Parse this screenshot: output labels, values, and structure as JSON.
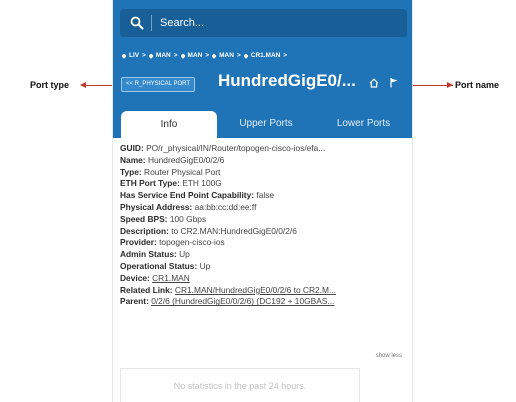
{
  "annotations": {
    "port_type": "Port type",
    "port_name": "Port name"
  },
  "search": {
    "placeholder": "Search..."
  },
  "breadcrumb": [
    "LIV",
    "MAN",
    "MAN",
    "MAN",
    "CR1.MAN"
  ],
  "breadcrumb_separator": ">",
  "header": {
    "port_type_badge": "<< R_PHYSICAL PORT",
    "port_name": "HundredGigE0/..."
  },
  "tabs": [
    "Info",
    "Upper Ports",
    "Lower Ports"
  ],
  "details": [
    {
      "label": "GUID:",
      "value": "PO/r_physical/IN/Router/topogen-cisco-ios/efa..."
    },
    {
      "label": "Name:",
      "value": "HundredGigE0/0/2/6"
    },
    {
      "label": "Type:",
      "value": "Router Physical Port"
    },
    {
      "label": "ETH Port Type:",
      "value": "ETH 100G"
    },
    {
      "label": "Has Service End Point Capability:",
      "value": "false"
    },
    {
      "label": "Physical Address:",
      "value": "aa:bb:cc:dd:ee:ff"
    },
    {
      "label": "Speed BPS:",
      "value": "100 Gbps"
    },
    {
      "label": "Description:",
      "value": "to CR2.MAN:HundredGigE0/0/2/6"
    },
    {
      "label": "Provider:",
      "value": "topogen-cisco-ios"
    },
    {
      "label": "Admin Status:",
      "value": "Up"
    },
    {
      "label": "Operational Status:",
      "value": "Up"
    },
    {
      "label": "Device:",
      "value": "CR1.MAN",
      "link": true
    },
    {
      "label": "Related Link:",
      "value": "CR1.MAN/HundredGigE0/0/2/6 to CR2.M...",
      "link": true
    },
    {
      "label": "Parent:",
      "value": "0/2/6 (HundredGigE0/0/2/6) (DC192 + 10GBAS...",
      "link": true
    }
  ],
  "show_less": "show less",
  "statistics": {
    "empty_text": "No statistics in the past 24 hours."
  },
  "colors": {
    "header_bg": "#1f74b8",
    "search_bg": "#185f98",
    "callout": "#c0392b"
  }
}
